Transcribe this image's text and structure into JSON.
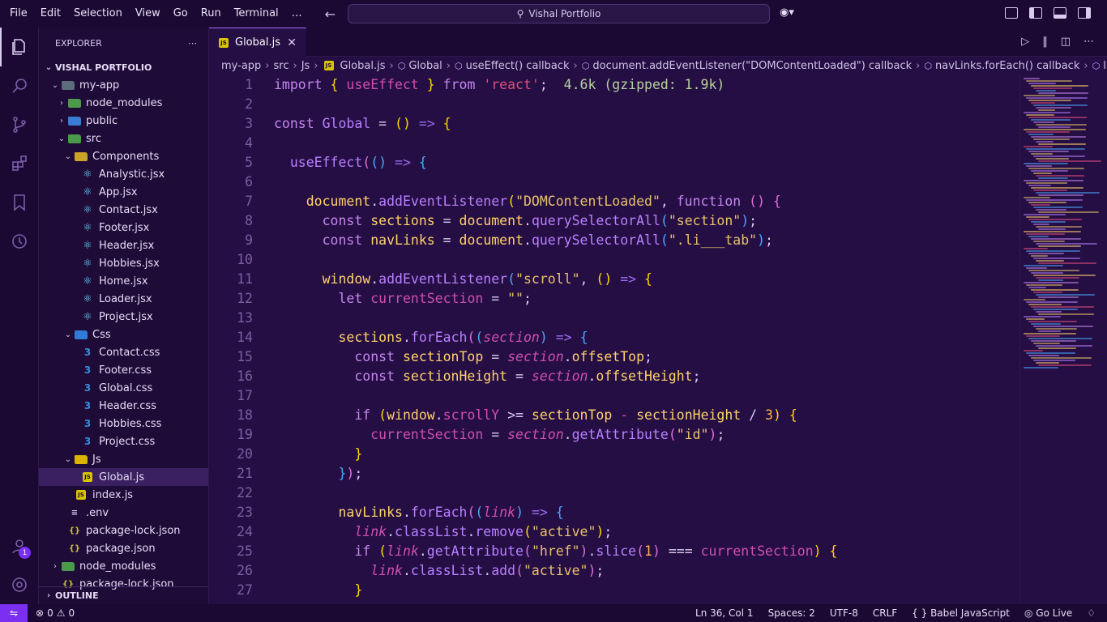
{
  "menu": [
    "File",
    "Edit",
    "Selection",
    "View",
    "Go",
    "Run",
    "Terminal",
    "…"
  ],
  "command_center": {
    "label": "Vishal Portfolio"
  },
  "explorer": {
    "title": "EXPLORER",
    "root": "VISHAL PORTFOLIO",
    "items": [
      {
        "label": "my-app",
        "depth": 1,
        "type": "folder-open"
      },
      {
        "label": "node_modules",
        "depth": 2,
        "type": "folder-green"
      },
      {
        "label": "public",
        "depth": 2,
        "type": "folder-blue"
      },
      {
        "label": "src",
        "depth": 2,
        "type": "folder-green-open"
      },
      {
        "label": "Components",
        "depth": 3,
        "type": "folder-react"
      },
      {
        "label": "Analystic.jsx",
        "depth": 4,
        "type": "react"
      },
      {
        "label": "App.jsx",
        "depth": 4,
        "type": "react"
      },
      {
        "label": "Contact.jsx",
        "depth": 4,
        "type": "react"
      },
      {
        "label": "Footer.jsx",
        "depth": 4,
        "type": "react"
      },
      {
        "label": "Header.jsx",
        "depth": 4,
        "type": "react"
      },
      {
        "label": "Hobbies.jsx",
        "depth": 4,
        "type": "react"
      },
      {
        "label": "Home.jsx",
        "depth": 4,
        "type": "react"
      },
      {
        "label": "Loader.jsx",
        "depth": 4,
        "type": "react"
      },
      {
        "label": "Project.jsx",
        "depth": 4,
        "type": "react"
      },
      {
        "label": "Css",
        "depth": 3,
        "type": "folder-css"
      },
      {
        "label": "Contact.css",
        "depth": 4,
        "type": "css"
      },
      {
        "label": "Footer.css",
        "depth": 4,
        "type": "css"
      },
      {
        "label": "Global.css",
        "depth": 4,
        "type": "css"
      },
      {
        "label": "Header.css",
        "depth": 4,
        "type": "css"
      },
      {
        "label": "Hobbies.css",
        "depth": 4,
        "type": "css"
      },
      {
        "label": "Project.css",
        "depth": 4,
        "type": "css"
      },
      {
        "label": "Js",
        "depth": 3,
        "type": "folder-js"
      },
      {
        "label": "Global.js",
        "depth": 4,
        "type": "js",
        "selected": true
      },
      {
        "label": "index.js",
        "depth": 3,
        "type": "js"
      },
      {
        "label": ".env",
        "depth": 2,
        "type": "env"
      },
      {
        "label": "package-lock.json",
        "depth": 2,
        "type": "json"
      },
      {
        "label": "package.json",
        "depth": 2,
        "type": "json"
      },
      {
        "label": "node_modules",
        "depth": 1,
        "type": "folder-green"
      },
      {
        "label": "package-lock.json",
        "depth": 1,
        "type": "json"
      }
    ],
    "outline": "OUTLINE"
  },
  "tab": {
    "label": "Global.js",
    "icon": "js-icon"
  },
  "breadcrumb": [
    "my-app",
    "src",
    "Js",
    "Global.js",
    "Global",
    "useEffect() callback",
    "document.addEventListener(\"DOMContentLoaded\") callback",
    "navLinks.forEach() callback",
    "link.addEventLi"
  ],
  "code": [
    [
      [
        "k",
        "import "
      ],
      [
        "b1",
        "{ "
      ],
      [
        "m",
        "useEffect"
      ],
      [
        "b1",
        " }"
      ],
      [
        "k",
        " from "
      ],
      [
        "s",
        "'react'"
      ],
      [
        "p",
        ";  "
      ],
      [
        "g",
        "4.6k (gzipped: 1.9k)"
      ]
    ],
    [],
    [
      [
        "k",
        "const "
      ],
      [
        "f",
        "Global"
      ],
      [
        "p",
        " = "
      ],
      [
        "b1",
        "()"
      ],
      [
        "o",
        " => "
      ],
      [
        "b1",
        "{"
      ]
    ],
    [],
    [
      [
        "p",
        "  "
      ],
      [
        "f",
        "useEffect"
      ],
      [
        "b2",
        "("
      ],
      [
        "b3",
        "()"
      ],
      [
        "o",
        " => "
      ],
      [
        "b3",
        "{"
      ]
    ],
    [],
    [
      [
        "p",
        "    "
      ],
      [
        "v",
        "document"
      ],
      [
        "p",
        "."
      ],
      [
        "f",
        "addEventListener"
      ],
      [
        "b1",
        "("
      ],
      [
        "str",
        "\"DOMContentLoaded\""
      ],
      [
        "p",
        ", "
      ],
      [
        "k",
        "function "
      ],
      [
        "b2",
        "() "
      ],
      [
        "b2",
        "{"
      ]
    ],
    [
      [
        "p",
        "      "
      ],
      [
        "k",
        "const "
      ],
      [
        "v",
        "sections"
      ],
      [
        "p",
        " = "
      ],
      [
        "v",
        "document"
      ],
      [
        "p",
        "."
      ],
      [
        "f",
        "querySelectorAll"
      ],
      [
        "b3",
        "("
      ],
      [
        "str",
        "\"section\""
      ],
      [
        "b3",
        ")"
      ],
      [
        "p",
        ";"
      ]
    ],
    [
      [
        "p",
        "      "
      ],
      [
        "k",
        "const "
      ],
      [
        "v",
        "navLinks"
      ],
      [
        "p",
        " = "
      ],
      [
        "v",
        "document"
      ],
      [
        "p",
        "."
      ],
      [
        "f",
        "querySelectorAll"
      ],
      [
        "b3",
        "("
      ],
      [
        "str",
        "\".li___tab\""
      ],
      [
        "b3",
        ")"
      ],
      [
        "p",
        ";"
      ]
    ],
    [],
    [
      [
        "p",
        "      "
      ],
      [
        "v",
        "window"
      ],
      [
        "p",
        "."
      ],
      [
        "f",
        "addEventListener"
      ],
      [
        "b3",
        "("
      ],
      [
        "str",
        "\"scroll\""
      ],
      [
        "p",
        ", "
      ],
      [
        "b1",
        "()"
      ],
      [
        "o",
        " => "
      ],
      [
        "b1",
        "{"
      ]
    ],
    [
      [
        "p",
        "        "
      ],
      [
        "k",
        "let "
      ],
      [
        "m",
        "currentSection"
      ],
      [
        "p",
        " = "
      ],
      [
        "str",
        "\"\""
      ],
      [
        "p",
        ";"
      ]
    ],
    [],
    [
      [
        "p",
        "        "
      ],
      [
        "v",
        "sections"
      ],
      [
        "p",
        "."
      ],
      [
        "f",
        "forEach"
      ],
      [
        "b2",
        "("
      ],
      [
        "b3",
        "("
      ],
      [
        "i",
        "section"
      ],
      [
        "b3",
        ")"
      ],
      [
        "o",
        " => "
      ],
      [
        "b3",
        "{"
      ]
    ],
    [
      [
        "p",
        "          "
      ],
      [
        "k",
        "const "
      ],
      [
        "v",
        "sectionTop"
      ],
      [
        "p",
        " = "
      ],
      [
        "i",
        "section"
      ],
      [
        "p",
        "."
      ],
      [
        "v",
        "offsetTop"
      ],
      [
        "p",
        ";"
      ]
    ],
    [
      [
        "p",
        "          "
      ],
      [
        "k",
        "const "
      ],
      [
        "v",
        "sectionHeight"
      ],
      [
        "p",
        " = "
      ],
      [
        "i",
        "section"
      ],
      [
        "p",
        "."
      ],
      [
        "v",
        "offsetHeight"
      ],
      [
        "p",
        ";"
      ]
    ],
    [],
    [
      [
        "p",
        "          "
      ],
      [
        "k",
        "if "
      ],
      [
        "b1",
        "("
      ],
      [
        "v",
        "window"
      ],
      [
        "p",
        "."
      ],
      [
        "m",
        "scrollY"
      ],
      [
        "p",
        " >= "
      ],
      [
        "v",
        "sectionTop"
      ],
      [
        "m",
        " - "
      ],
      [
        "v",
        "sectionHeight"
      ],
      [
        "p",
        " / "
      ],
      [
        "num",
        "3"
      ],
      [
        "b1",
        ")"
      ],
      [
        "b1",
        " {"
      ]
    ],
    [
      [
        "p",
        "            "
      ],
      [
        "m",
        "currentSection"
      ],
      [
        "p",
        " = "
      ],
      [
        "i",
        "section"
      ],
      [
        "p",
        "."
      ],
      [
        "f",
        "getAttribute"
      ],
      [
        "b2",
        "("
      ],
      [
        "str",
        "\"id\""
      ],
      [
        "b2",
        ")"
      ],
      [
        "p",
        ";"
      ]
    ],
    [
      [
        "p",
        "          "
      ],
      [
        "b1",
        "}"
      ]
    ],
    [
      [
        "p",
        "        "
      ],
      [
        "b3",
        "}"
      ],
      [
        "b2",
        ")"
      ],
      [
        "p",
        ";"
      ]
    ],
    [],
    [
      [
        "p",
        "        "
      ],
      [
        "v",
        "navLinks"
      ],
      [
        "p",
        "."
      ],
      [
        "f",
        "forEach"
      ],
      [
        "b2",
        "("
      ],
      [
        "b3",
        "("
      ],
      [
        "i",
        "link"
      ],
      [
        "b3",
        ")"
      ],
      [
        "o",
        " => "
      ],
      [
        "b3",
        "{"
      ]
    ],
    [
      [
        "p",
        "          "
      ],
      [
        "i",
        "link"
      ],
      [
        "p",
        "."
      ],
      [
        "f",
        "classList"
      ],
      [
        "p",
        "."
      ],
      [
        "f",
        "remove"
      ],
      [
        "b1",
        "("
      ],
      [
        "str",
        "\"active\""
      ],
      [
        "b1",
        ")"
      ],
      [
        "p",
        ";"
      ]
    ],
    [
      [
        "p",
        "          "
      ],
      [
        "k",
        "if "
      ],
      [
        "b1",
        "("
      ],
      [
        "i",
        "link"
      ],
      [
        "p",
        "."
      ],
      [
        "f",
        "getAttribute"
      ],
      [
        "b2",
        "("
      ],
      [
        "str",
        "\"href\""
      ],
      [
        "b2",
        ")"
      ],
      [
        "p",
        "."
      ],
      [
        "f",
        "slice"
      ],
      [
        "b2",
        "("
      ],
      [
        "num",
        "1"
      ],
      [
        "b2",
        ")"
      ],
      [
        "p",
        " === "
      ],
      [
        "m",
        "currentSection"
      ],
      [
        "b1",
        ")"
      ],
      [
        "b1",
        " {"
      ]
    ],
    [
      [
        "p",
        "            "
      ],
      [
        "i",
        "link"
      ],
      [
        "p",
        "."
      ],
      [
        "f",
        "classList"
      ],
      [
        "p",
        "."
      ],
      [
        "f",
        "add"
      ],
      [
        "b2",
        "("
      ],
      [
        "str",
        "\"active\""
      ],
      [
        "b2",
        ")"
      ],
      [
        "p",
        ";"
      ]
    ],
    [
      [
        "p",
        "          "
      ],
      [
        "b1",
        "}"
      ]
    ]
  ],
  "status": {
    "errors": "0",
    "warnings": "0",
    "position": "Ln 36, Col 1",
    "spaces": "Spaces: 2",
    "encoding": "UTF-8",
    "eol": "CRLF",
    "language": "{ } Babel JavaScript",
    "golive": "Go Live"
  },
  "accounts_badge": "1",
  "colors": {
    "accent": "#7b2ff0",
    "bg": "#250e44"
  }
}
